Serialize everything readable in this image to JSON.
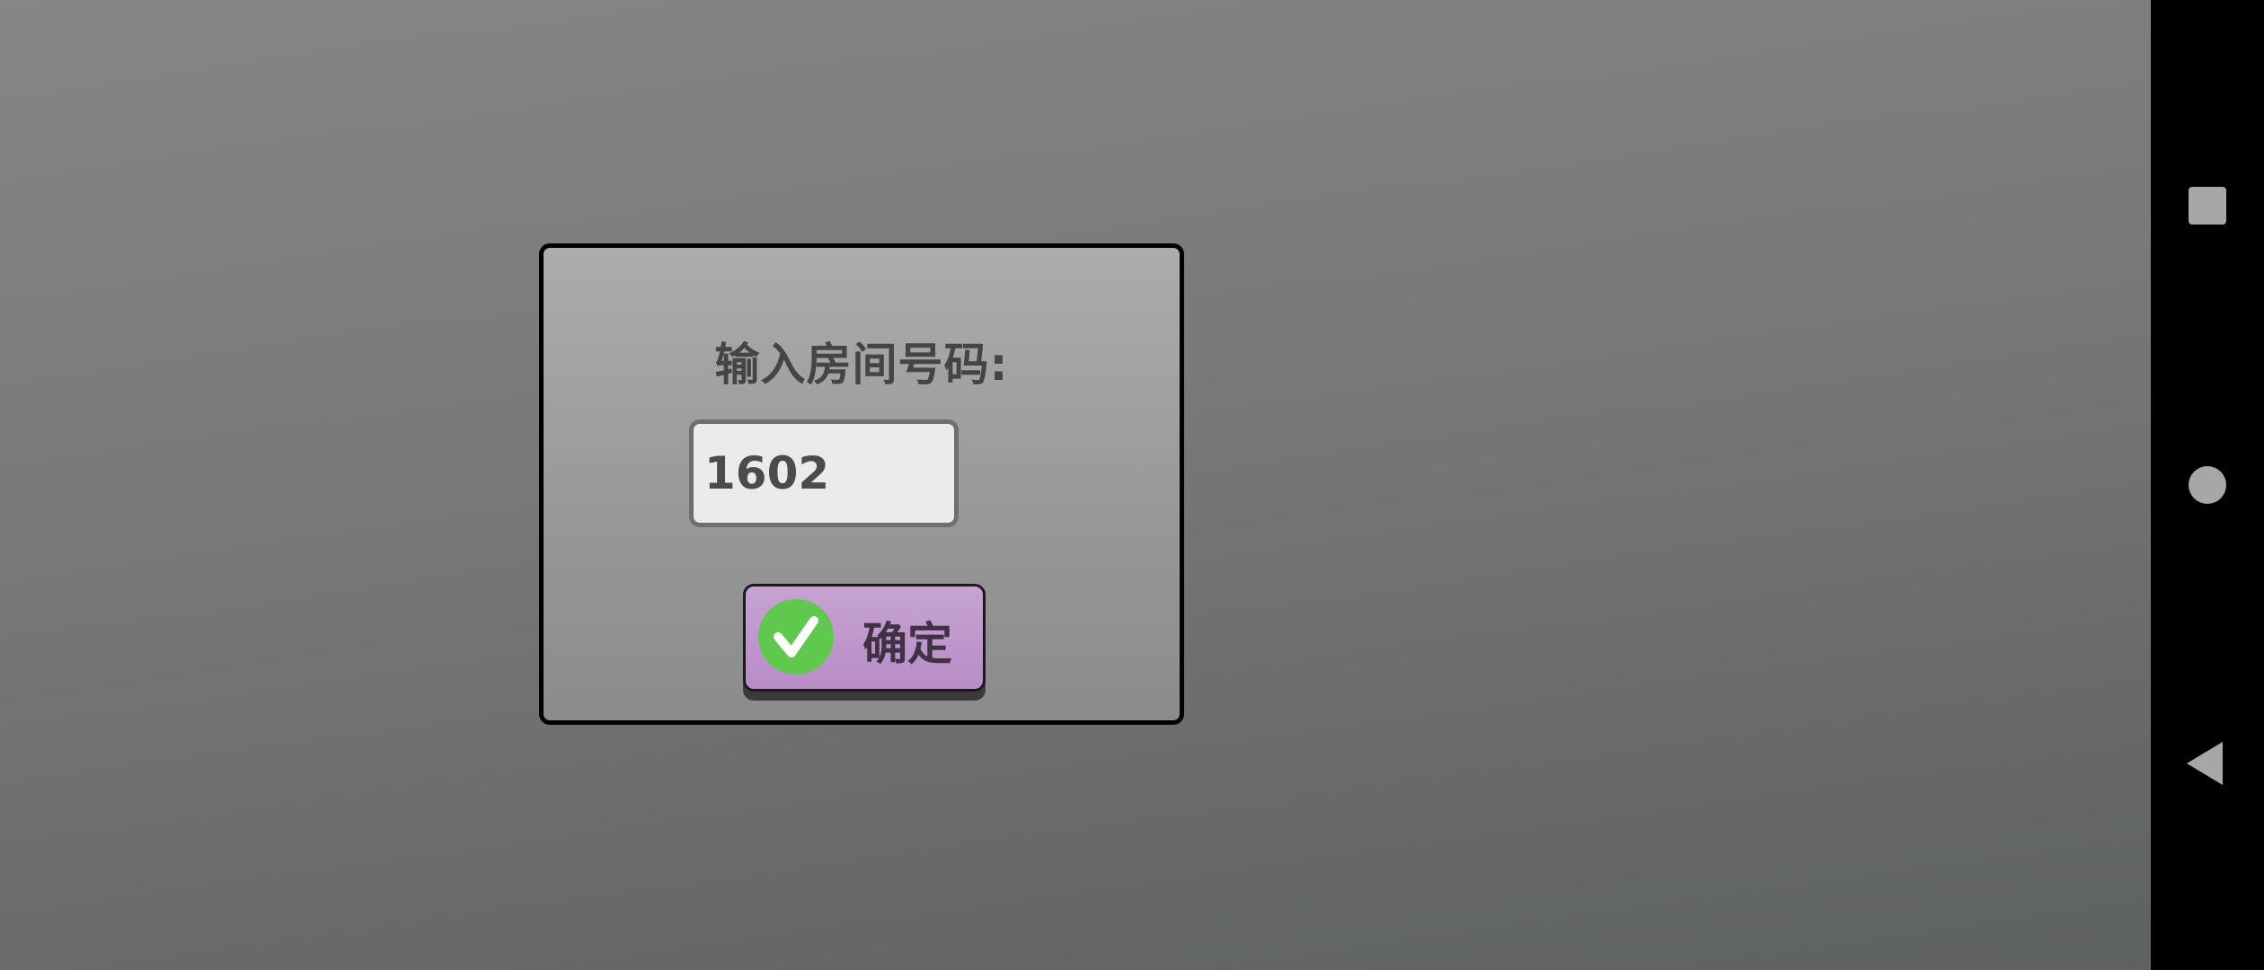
{
  "dialog": {
    "title": "输入房间号码:",
    "room_input_value": "1602",
    "confirm_label": "确定"
  },
  "nav": {
    "recent_icon": "square-icon",
    "home_icon": "circle-icon",
    "back_icon": "triangle-back-icon"
  },
  "colors": {
    "background": "#777877",
    "dialog_border": "#000000",
    "button_purple": "#c6a3d3",
    "check_green": "#5fc94d",
    "nav_bar": "#000000",
    "nav_icon": "#a7a7a7"
  }
}
